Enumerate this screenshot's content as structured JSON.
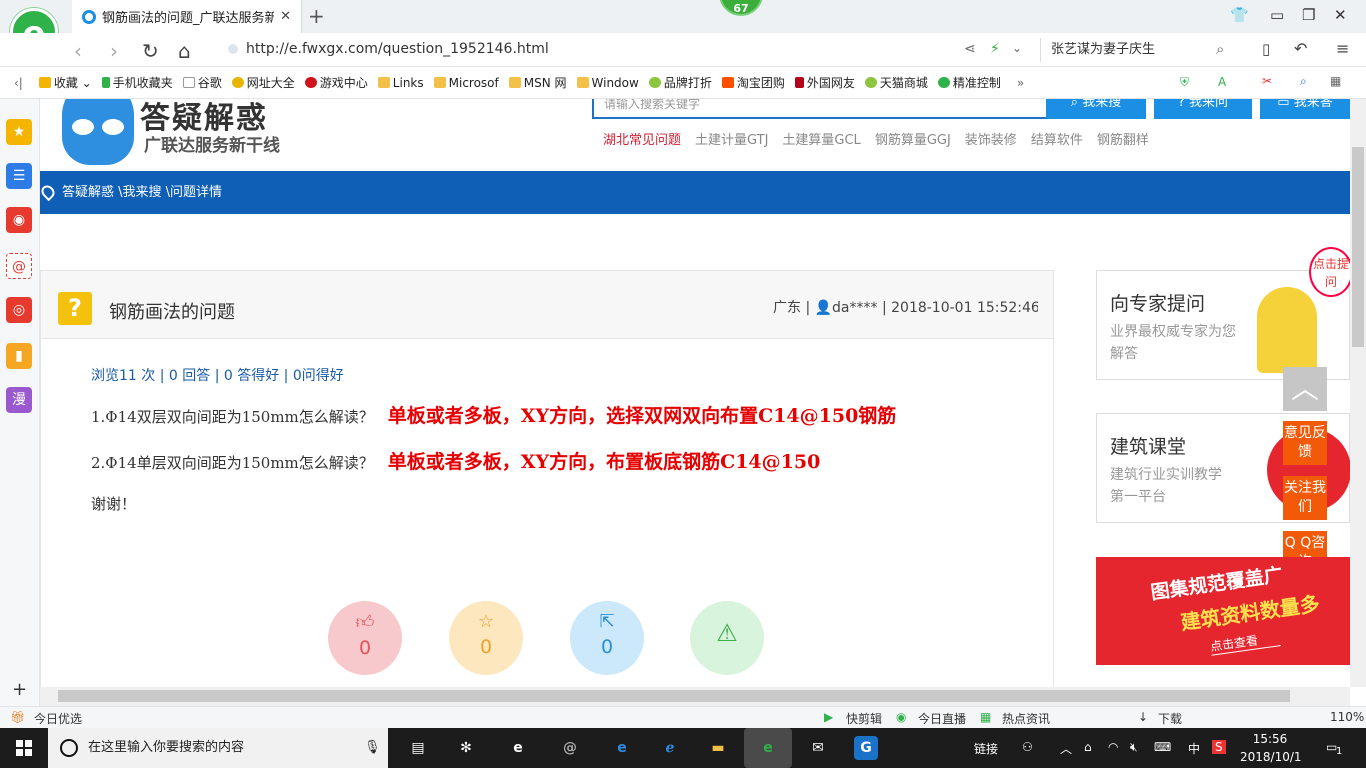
{
  "browser": {
    "tab_title": "钢筋画法的问题_广联达服务新干",
    "tab_close": "✕",
    "new_tab": "+",
    "counter_badge": "67",
    "url": "http://e.fwxgx.com/question_1952146.html",
    "hot_search": "张艺谋为妻子庆生",
    "win_min": "▭",
    "win_max": "❐",
    "win_close": "✕"
  },
  "bookmarks": [
    {
      "label": "收藏",
      "icon": "star-icon"
    },
    {
      "label": "手机收藏夹",
      "icon": "phone-icon"
    },
    {
      "label": "谷歌",
      "icon": "page-icon"
    },
    {
      "label": "网址大全",
      "icon": "globe-icon"
    },
    {
      "label": "游戏中心",
      "icon": "game-icon"
    },
    {
      "label": "Links",
      "icon": "folder-icon"
    },
    {
      "label": "Microsof",
      "icon": "folder-icon"
    },
    {
      "label": "MSN 网",
      "icon": "folder-icon"
    },
    {
      "label": "Window",
      "icon": "folder-icon"
    },
    {
      "label": "品牌打折",
      "icon": "leaf-icon"
    },
    {
      "label": "淘宝团购",
      "icon": "taobao-icon"
    },
    {
      "label": "外国网友",
      "icon": "page-icon"
    },
    {
      "label": "天猫商城",
      "icon": "leaf-icon"
    },
    {
      "label": "精准控制",
      "icon": "wechat-icon"
    }
  ],
  "site": {
    "title": "答疑解惑",
    "subtitle": "广联达服务新干线",
    "search_placeholder": "请输入搜索关键字",
    "search_button": "我来搜",
    "ask_button": "我来问",
    "answer_button": "我来答",
    "hot_links": [
      "湖北常见问题",
      "土建计量GTJ",
      "土建算量GCL",
      "钢筋算量GGJ",
      "装饰装修",
      "结算软件",
      "钢筋翻样"
    ],
    "breadcrumb": "答疑解惑 \\我来搜 \\问题详情"
  },
  "question": {
    "icon": "?",
    "title": "钢筋画法的问题",
    "meta": "广东 | 👤da**** | 2018-10-01 15:52:46",
    "stats": "浏览11 次 | 0 回答 | 0 答得好 | 0问得好",
    "line1": "1.Φ14双层双向间距为150mm怎么解读？",
    "line1_answer": "单板或者多板，XY方向，选择双网双向布置C14@150钢筋",
    "line2": "2.Φ14单层双向间距为150mm怎么解读？",
    "line2_answer": "单板或者多板，XY方向，布置板底钢筋C14@150",
    "thanks": "谢谢！",
    "actions": [
      {
        "icon": "thumbs-up-icon",
        "count": "0",
        "color": "#f7c9cc",
        "fg": "#e6525a"
      },
      {
        "icon": "star-icon",
        "count": "0",
        "color": "#fde7bf",
        "fg": "#f0a02a"
      },
      {
        "icon": "share-icon",
        "count": "0",
        "color": "#cce9fb",
        "fg": "#2b8fd8"
      },
      {
        "icon": "warning-icon",
        "count": "",
        "color": "#d9f4dc",
        "fg": "#3cae4a"
      }
    ]
  },
  "sidebar_right": {
    "expert_title": "向专家提问",
    "expert_sub": "业界最权威专家为您解答",
    "expert_bubble": "点击提问",
    "course_title": "建筑课堂",
    "course_sub": "建筑行业实训教学第一平台",
    "feedback": "意见反馈",
    "follow": "关注我们",
    "qq": "Q Q咨询",
    "banner_line1": "图集规范覆盖广",
    "banner_line2": "建筑资料数量多",
    "banner_link": "点击查看"
  },
  "statusbar": {
    "left": "今日优选",
    "items": [
      "快剪辑",
      "今日直播",
      "热点资讯",
      "下载"
    ],
    "zoom": "110%"
  },
  "taskbar": {
    "search_placeholder": "在这里输入你要搜索的内容",
    "tray_link": "链接",
    "ime": "中",
    "time": "15:56",
    "date": "2018/10/1",
    "notif_count": "1"
  }
}
